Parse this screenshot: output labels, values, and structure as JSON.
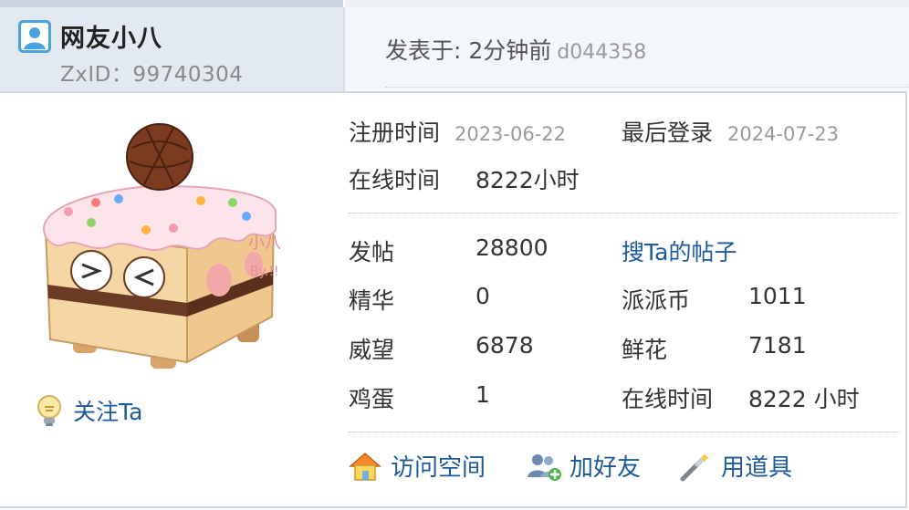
{
  "header": {
    "username": "网友小八",
    "zxid": "ZxID：99740304",
    "posted": "发表于: 2分钟前",
    "post_id": "d044358"
  },
  "profile": {
    "follow_label": "关注Ta",
    "register_label": "注册时间",
    "register_value": "2023-06-22",
    "lastlogin_label": "最后登录",
    "lastlogin_value": "2024-07-23",
    "online_label": "在线时间",
    "online_value": "8222小时",
    "stats": [
      {
        "label": "发帖",
        "value": "28800"
      },
      {
        "label": "精华",
        "value": "0"
      },
      {
        "label": "威望",
        "value": "6878"
      },
      {
        "label": "鸡蛋",
        "value": "1"
      }
    ],
    "search_posts": "搜Ta的帖子",
    "stats_right": [
      {
        "label": "派派币",
        "value": "1011"
      },
      {
        "label": "鲜花",
        "value": "7181"
      },
      {
        "label": "在线时间",
        "value": "8222 小时"
      }
    ]
  },
  "actions": {
    "visit_space": "访问空间",
    "add_friend": "加好友",
    "use_item": "用道具"
  },
  "avatar": {
    "tag_text": "小八",
    "tag_sub": "By.!!"
  },
  "colors": {
    "link": "#1d5a9b",
    "header_bg": "#e3e9f0",
    "muted": "#9a9a9a"
  }
}
